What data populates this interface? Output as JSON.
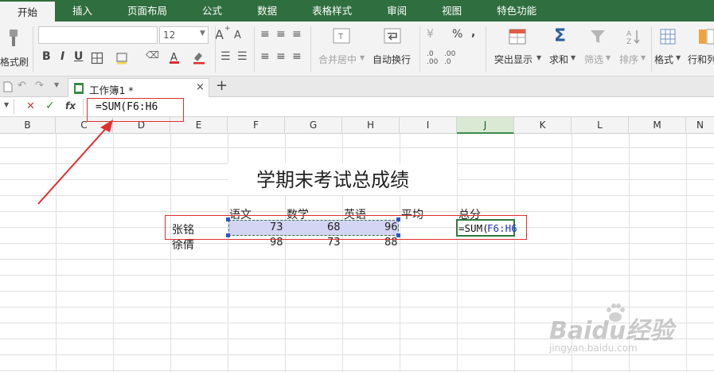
{
  "menu": {
    "tabs": [
      "开始",
      "插入",
      "页面布局",
      "公式",
      "数据",
      "表格样式",
      "审阅",
      "视图",
      "特色功能"
    ],
    "active_index": 0
  },
  "ribbon": {
    "format_painter": "格式刷",
    "font_name": "",
    "font_size": "12",
    "bold": "B",
    "italic": "I",
    "underline": "U",
    "grow_font": "A",
    "shrink_font": "A",
    "merge_center": "合并居中",
    "wrap_text": "自动换行",
    "percent": "%",
    "thousands": ",",
    "inc_decimal_top": ".0",
    "inc_decimal_bot": ".00",
    "dec_decimal_top": ".00",
    "dec_decimal_bot": ".0",
    "conditional_format": "突出显示",
    "sum": "求和",
    "filter": "筛选",
    "sort": "排序",
    "format": "格式",
    "rows_cols": "行和列"
  },
  "doc_tabs": {
    "name": "工作簿1 *",
    "close": "×",
    "add": "+"
  },
  "formula_bar": {
    "name_box": "",
    "cancel": "✕",
    "confirm": "✓",
    "fx": "fx",
    "formula": "=SUM(F6:H6"
  },
  "columns": [
    "B",
    "C",
    "D",
    "E",
    "F",
    "G",
    "H",
    "I",
    "J",
    "K",
    "L",
    "M",
    "N"
  ],
  "selected_column": "J",
  "sheet": {
    "title": "学期末考试总成绩",
    "headers": [
      "语文",
      "数学",
      "英语",
      "平均",
      "总分"
    ],
    "rows": [
      {
        "name": "张铭",
        "scores": [
          "73",
          "68",
          "96"
        ]
      },
      {
        "name": "徐倩",
        "scores": [
          "98",
          "73",
          "88"
        ]
      }
    ],
    "editing_cell_prefix": "=SUM(",
    "editing_cell_ref": "F6:H6"
  },
  "watermark": {
    "brand": "Baidu经验",
    "url": "jingyan.baidu.com"
  },
  "colors": {
    "menu_bg": "#2f6e3e",
    "annotation_red": "#e03030",
    "selection_fill": "#d4d4f4",
    "reference_blue": "#1a33cc"
  }
}
